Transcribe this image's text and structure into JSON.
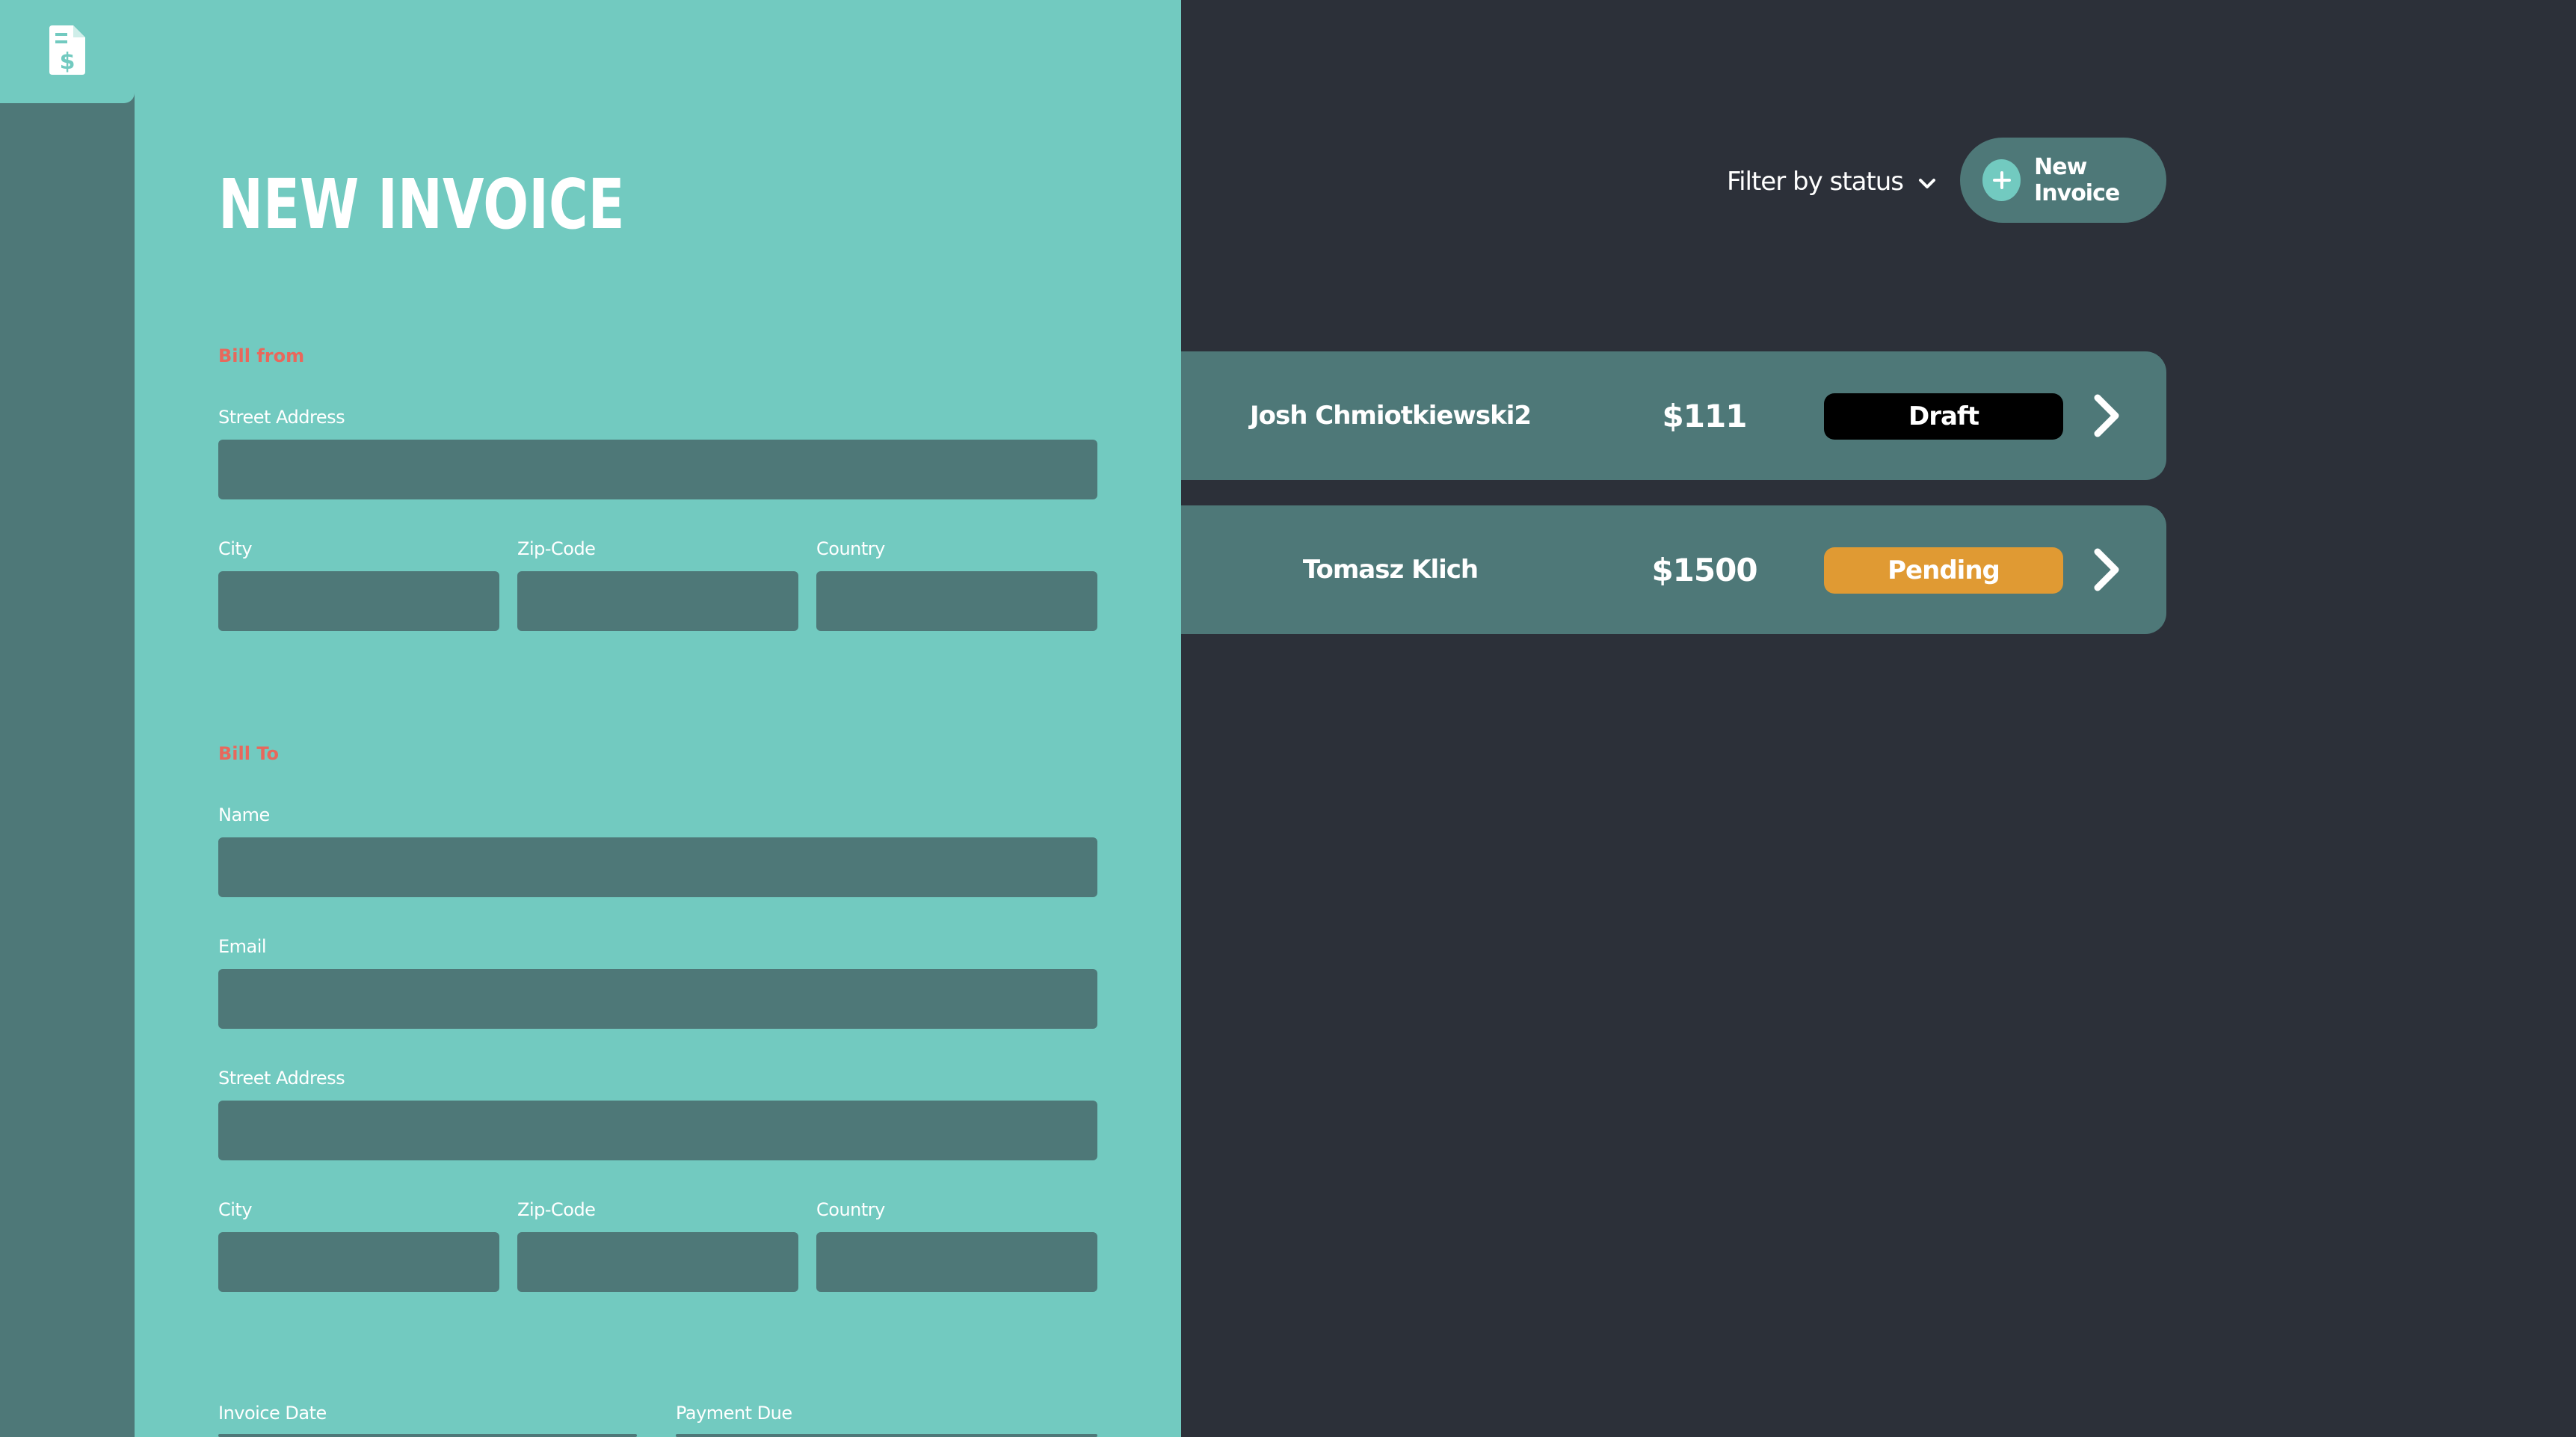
{
  "sidebar": {
    "logo_icon": "invoice-dollar-icon"
  },
  "toolbar": {
    "filter_label": "Filter by status",
    "new_invoice_label": "New Invoice"
  },
  "invoices": [
    {
      "name": "Josh Chmiotkiewski2",
      "amount": "$111",
      "status": "Draft"
    },
    {
      "name": "Tomasz Klich",
      "amount": "$1500",
      "status": "Pending"
    }
  ],
  "form": {
    "title": "NEW INVOICE",
    "bill_from": {
      "section_label": "Bill from",
      "street_label": "Street Address",
      "city_label": "City",
      "zip_label": "Zip-Code",
      "country_label": "Country"
    },
    "bill_to": {
      "section_label": "Bill To",
      "name_label": "Name",
      "email_label": "Email",
      "street_label": "Street Address",
      "city_label": "City",
      "zip_label": "Zip-Code",
      "country_label": "Country"
    },
    "dates": {
      "invoice_date_label": "Invoice Date",
      "payment_due_label": "Payment Due"
    }
  },
  "colors": {
    "background": "#2c3039",
    "panel": "#72cac0",
    "accent_dark": "#4e7878",
    "section_label": "#e8685c",
    "status_draft": "#000000",
    "status_pending": "#e09a33"
  }
}
